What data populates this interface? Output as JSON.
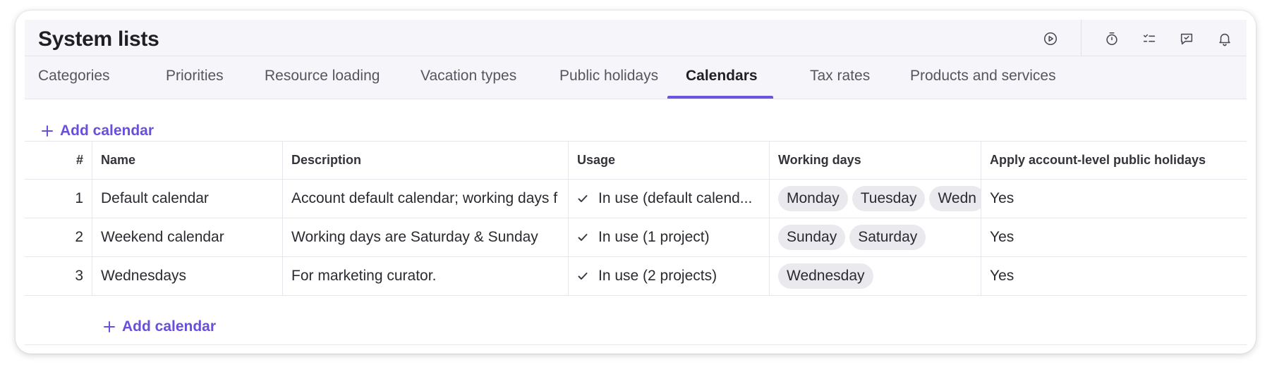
{
  "header": {
    "title": "System lists"
  },
  "header_icons": [
    "play-circle-icon",
    "timer-icon",
    "checklist-icon",
    "chat-icon",
    "bell-icon"
  ],
  "tabs": [
    {
      "label": "Categories"
    },
    {
      "label": "Priorities"
    },
    {
      "label": "Resource loading"
    },
    {
      "label": "Vacation types"
    },
    {
      "label": "Public holidays"
    },
    {
      "label": "Calendars",
      "active": true
    },
    {
      "label": "Tax rates"
    },
    {
      "label": "Products and services"
    }
  ],
  "actions": {
    "add_calendar_top": "Add calendar",
    "add_calendar_bottom": "Add calendar"
  },
  "table": {
    "columns": [
      "#",
      "Name",
      "Description",
      "Usage",
      "Working days",
      "Apply account-level public holidays"
    ],
    "rows": [
      {
        "num": "1",
        "name": "Default calendar",
        "description": "Account default calendar; working days f",
        "usage": "In use (default calend...",
        "days": [
          "Monday",
          "Tuesday",
          "Wedn"
        ],
        "holidays": "Yes"
      },
      {
        "num": "2",
        "name": "Weekend calendar",
        "description": "Working days are Saturday & Sunday",
        "usage": "In use (1 project)",
        "days": [
          "Sunday",
          "Saturday"
        ],
        "holidays": "Yes"
      },
      {
        "num": "3",
        "name": "Wednesdays",
        "description": "For marketing curator.",
        "usage": "In use (2 projects)",
        "days": [
          "Wednesday"
        ],
        "holidays": "Yes"
      }
    ]
  },
  "colors": {
    "accent": "#6a4fdc",
    "tab_underline": "#6a55e0",
    "header_bg": "#f6f6fa",
    "chip_bg": "#e9e9ee"
  }
}
